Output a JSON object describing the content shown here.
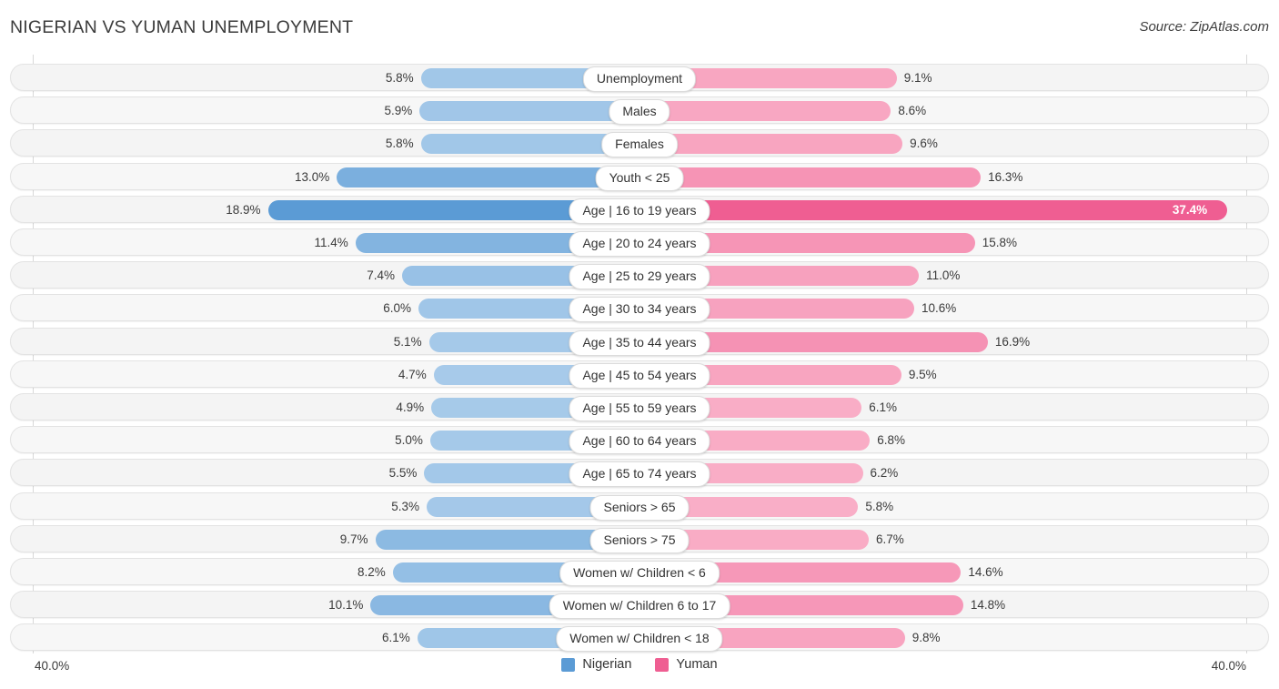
{
  "header": {
    "title": "NIGERIAN VS YUMAN UNEMPLOYMENT",
    "source": "Source: ZipAtlas.com"
  },
  "axis": {
    "left_max_label": "40.0%",
    "right_max_label": "40.0%"
  },
  "legend": {
    "items": [
      {
        "label": "Nigerian",
        "color": "#5b9bd5"
      },
      {
        "label": "Yuman",
        "color": "#ef5e92"
      }
    ]
  },
  "colors": {
    "left_bar": "#9dc3e6",
    "left_bar_strong": "#5b9bd5",
    "right_bar": "#f59ebc",
    "right_bar_strong": "#ef5e92",
    "row_bg": "#f4f4f4",
    "pill_bg": "#ffffff"
  },
  "chart_data": {
    "type": "bar",
    "title": "NIGERIAN VS YUMAN UNEMPLOYMENT",
    "subtitle": "",
    "orientation": "horizontal-diverging",
    "xlabel": "",
    "ylabel": "",
    "xlim": [
      40.0,
      40.0
    ],
    "grid": false,
    "legend_position": "bottom-center",
    "series": [
      {
        "name": "Nigerian",
        "color": "#5b9bd5",
        "side": "left",
        "values": [
          5.8,
          5.9,
          5.8,
          13.0,
          18.9,
          11.4,
          7.4,
          6.0,
          5.1,
          4.7,
          4.9,
          5.0,
          5.5,
          5.3,
          9.7,
          8.2,
          10.1,
          6.1
        ]
      },
      {
        "name": "Yuman",
        "color": "#ef5e92",
        "side": "right",
        "values": [
          9.1,
          8.6,
          9.6,
          16.3,
          37.4,
          15.8,
          11.0,
          10.6,
          16.9,
          9.5,
          6.1,
          6.8,
          6.2,
          5.8,
          6.7,
          14.6,
          14.8,
          9.8
        ]
      }
    ],
    "categories": [
      "Unemployment",
      "Males",
      "Females",
      "Youth < 25",
      "Age | 16 to 19 years",
      "Age | 20 to 24 years",
      "Age | 25 to 29 years",
      "Age | 30 to 34 years",
      "Age | 35 to 44 years",
      "Age | 45 to 54 years",
      "Age | 55 to 59 years",
      "Age | 60 to 64 years",
      "Age | 65 to 74 years",
      "Seniors > 65",
      "Seniors > 75",
      "Women w/ Children < 6",
      "Women w/ Children 6 to 17",
      "Women w/ Children < 18"
    ]
  },
  "rows": [
    {
      "category": "Unemployment",
      "left_value": 5.8,
      "right_value": 9.1,
      "left_label": "5.8%",
      "right_label": "9.1%"
    },
    {
      "category": "Males",
      "left_value": 5.9,
      "right_value": 8.6,
      "left_label": "5.9%",
      "right_label": "8.6%"
    },
    {
      "category": "Females",
      "left_value": 5.8,
      "right_value": 9.6,
      "left_label": "5.8%",
      "right_label": "9.6%"
    },
    {
      "category": "Youth < 25",
      "left_value": 13.0,
      "right_value": 16.3,
      "left_label": "13.0%",
      "right_label": "16.3%"
    },
    {
      "category": "Age | 16 to 19 years",
      "left_value": 18.9,
      "right_value": 37.4,
      "left_label": "18.9%",
      "right_label": "37.4%"
    },
    {
      "category": "Age | 20 to 24 years",
      "left_value": 11.4,
      "right_value": 15.8,
      "left_label": "11.4%",
      "right_label": "15.8%"
    },
    {
      "category": "Age | 25 to 29 years",
      "left_value": 7.4,
      "right_value": 11.0,
      "left_label": "7.4%",
      "right_label": "11.0%"
    },
    {
      "category": "Age | 30 to 34 years",
      "left_value": 6.0,
      "right_value": 10.6,
      "left_label": "6.0%",
      "right_label": "10.6%"
    },
    {
      "category": "Age | 35 to 44 years",
      "left_value": 5.1,
      "right_value": 16.9,
      "left_label": "5.1%",
      "right_label": "16.9%"
    },
    {
      "category": "Age | 45 to 54 years",
      "left_value": 4.7,
      "right_value": 9.5,
      "left_label": "4.7%",
      "right_label": "9.5%"
    },
    {
      "category": "Age | 55 to 59 years",
      "left_value": 4.9,
      "right_value": 6.1,
      "left_label": "4.9%",
      "right_label": "6.1%"
    },
    {
      "category": "Age | 60 to 64 years",
      "left_value": 5.0,
      "right_value": 6.8,
      "left_label": "5.0%",
      "right_label": "6.8%"
    },
    {
      "category": "Age | 65 to 74 years",
      "left_value": 5.5,
      "right_value": 6.2,
      "left_label": "5.5%",
      "right_label": "6.2%"
    },
    {
      "category": "Seniors > 65",
      "left_value": 5.3,
      "right_value": 5.8,
      "left_label": "5.3%",
      "right_label": "5.8%"
    },
    {
      "category": "Seniors > 75",
      "left_value": 9.7,
      "right_value": 6.7,
      "left_label": "9.7%",
      "right_label": "6.7%"
    },
    {
      "category": "Women w/ Children < 6",
      "left_value": 8.2,
      "right_value": 14.6,
      "left_label": "8.2%",
      "right_label": "14.6%"
    },
    {
      "category": "Women w/ Children 6 to 17",
      "left_value": 10.1,
      "right_value": 14.8,
      "left_label": "10.1%",
      "right_label": "14.8%"
    },
    {
      "category": "Women w/ Children < 18",
      "left_value": 6.1,
      "right_value": 9.8,
      "left_label": "6.1%",
      "right_label": "9.8%"
    }
  ]
}
